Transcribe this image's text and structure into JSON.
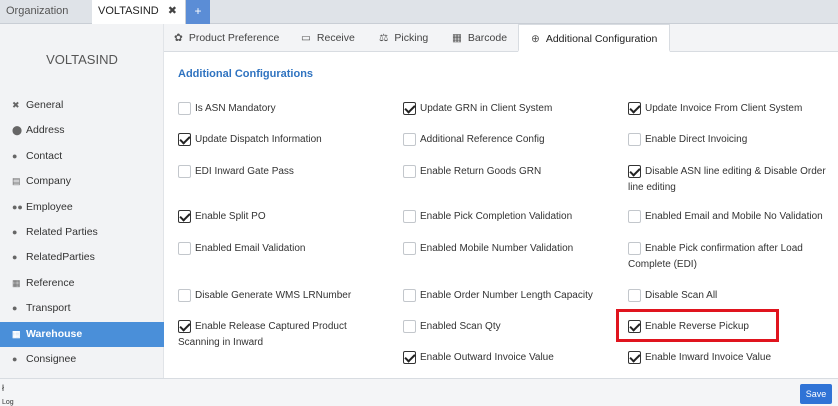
{
  "top_tabs": {
    "organization": "Organization",
    "active_tab": "VOLTASIND",
    "close_glyph": "✖",
    "add_glyph": "+"
  },
  "sidebar": {
    "company": "VOLTASIND",
    "items": [
      {
        "label": "General",
        "icon": "✖",
        "icon_name": "tools-icon"
      },
      {
        "label": "Address",
        "icon": "⬤",
        "icon_name": "map-marker-icon"
      },
      {
        "label": "Contact",
        "icon": "●",
        "icon_name": "user-icon"
      },
      {
        "label": "Company",
        "icon": "▤",
        "icon_name": "building-icon"
      },
      {
        "label": "Employee",
        "icon": "●●",
        "icon_name": "users-icon"
      },
      {
        "label": "Related Parties",
        "icon": "●",
        "icon_name": "user-icon"
      },
      {
        "label": "RelatedParties",
        "icon": "●",
        "icon_name": "user-icon"
      },
      {
        "label": "Reference",
        "icon": "▦",
        "icon_name": "table-icon"
      },
      {
        "label": "Transport",
        "icon": "●",
        "icon_name": "user-icon"
      },
      {
        "label": "Warehouse",
        "icon": "▦",
        "icon_name": "warehouse-icon"
      },
      {
        "label": "Consignee",
        "icon": "●",
        "icon_name": "user-icon"
      }
    ],
    "active_index": 9
  },
  "sub_tabs": [
    {
      "label": "Product Preference",
      "icon": "✿",
      "icon_name": "cogs-icon"
    },
    {
      "label": "Receive",
      "icon": "▭",
      "icon_name": "receive-icon"
    },
    {
      "label": "Picking",
      "icon": "⚖",
      "icon_name": "picking-icon"
    },
    {
      "label": "Barcode",
      "icon": "▦",
      "icon_name": "barcode-icon"
    },
    {
      "label": "Additional Configuration",
      "icon": "⊕",
      "icon_name": "plus-circle-icon"
    }
  ],
  "section_title": "Additional Configurations",
  "options": [
    {
      "label": "Is ASN Mandatory",
      "checked": false
    },
    {
      "label": "Update GRN in Client System",
      "checked": true
    },
    {
      "label": "Update Invoice From Client System",
      "checked": true
    },
    {
      "label": "Update Dispatch Information",
      "checked": true
    },
    {
      "label": "Additional Reference Config",
      "checked": false
    },
    {
      "label": "Enable Direct Invoicing",
      "checked": false
    },
    {
      "label": "EDI Inward Gate Pass",
      "checked": false
    },
    {
      "label": "Enable Return Goods GRN",
      "checked": false
    },
    {
      "label": "Disable ASN line editing & Disable Order line editing",
      "checked": true
    },
    {
      "label": "Enable Split PO",
      "checked": true
    },
    {
      "label": "Enable Pick Completion Validation",
      "checked": false
    },
    {
      "label": "Enabled Email and Mobile No Validation",
      "checked": false
    },
    {
      "label": "Enabled Email Validation",
      "checked": false
    },
    {
      "label": "Enabled Mobile Number Validation",
      "checked": false
    },
    {
      "label": "Enable Pick confirmation after Load Complete (EDI)",
      "checked": false
    },
    {
      "label": "Disable Generate WMS LRNumber",
      "checked": false
    },
    {
      "label": "Enable Order Number Length Capacity",
      "checked": false
    },
    {
      "label": "Disable Scan All",
      "checked": false
    },
    {
      "label": "Enable Release Captured Product Scanning in Inward",
      "checked": true
    },
    {
      "label": "Enabled Scan Qty",
      "checked": false
    },
    {
      "label": "Enable Reverse Pickup",
      "checked": true
    },
    {
      "label": "Enable Outward Invoice Value",
      "checked": true
    },
    {
      "label": "Enable Inward Invoice Value",
      "checked": true
    }
  ],
  "bottom": {
    "log_icon": "ł",
    "log_label": "Log",
    "save_label": "Save"
  },
  "colors": {
    "accent": "#4a8fd9",
    "section_title": "#2f73c0",
    "highlight": "#e0141e",
    "save_button": "#2f73d6"
  }
}
